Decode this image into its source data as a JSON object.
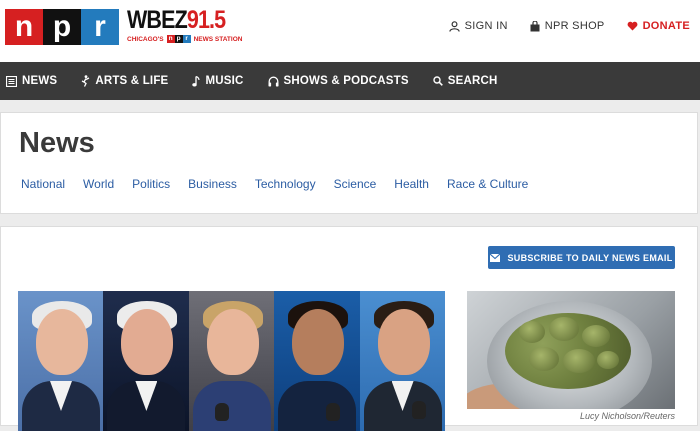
{
  "header": {
    "logo_letters": [
      "n",
      "p",
      "r"
    ],
    "station_name": "WBEZ",
    "station_freq": "91.5",
    "station_tag_left": "CHICAGO'S",
    "station_tag_letters": [
      "n",
      "p",
      "r"
    ],
    "station_tag_right": "NEWS STATION",
    "links": {
      "sign_in": "SIGN IN",
      "npr_shop": "NPR SHOP",
      "donate": "DONATE"
    }
  },
  "nav": {
    "items": [
      {
        "label": "NEWS",
        "icon": "news-icon"
      },
      {
        "label": "ARTS & LIFE",
        "icon": "arts-icon"
      },
      {
        "label": "MUSIC",
        "icon": "music-note-icon"
      },
      {
        "label": "SHOWS & PODCASTS",
        "icon": "headphones-icon"
      },
      {
        "label": "SEARCH",
        "icon": "search-icon"
      }
    ]
  },
  "section": {
    "title": "News",
    "subnav": [
      "National",
      "World",
      "Politics",
      "Business",
      "Technology",
      "Science",
      "Health",
      "Race & Culture"
    ]
  },
  "content": {
    "subscribe_label": "SUBSCRIBE TO DAILY NEWS EMAIL",
    "photo_credit": "Lucy Nicholson/Reuters"
  },
  "colors": {
    "npr_red": "#d62021",
    "npr_black": "#111111",
    "npr_blue": "#237bbd",
    "nav_bg": "#3a3a3a",
    "link_blue": "#2c5da3",
    "button_blue": "#2f6db3"
  }
}
